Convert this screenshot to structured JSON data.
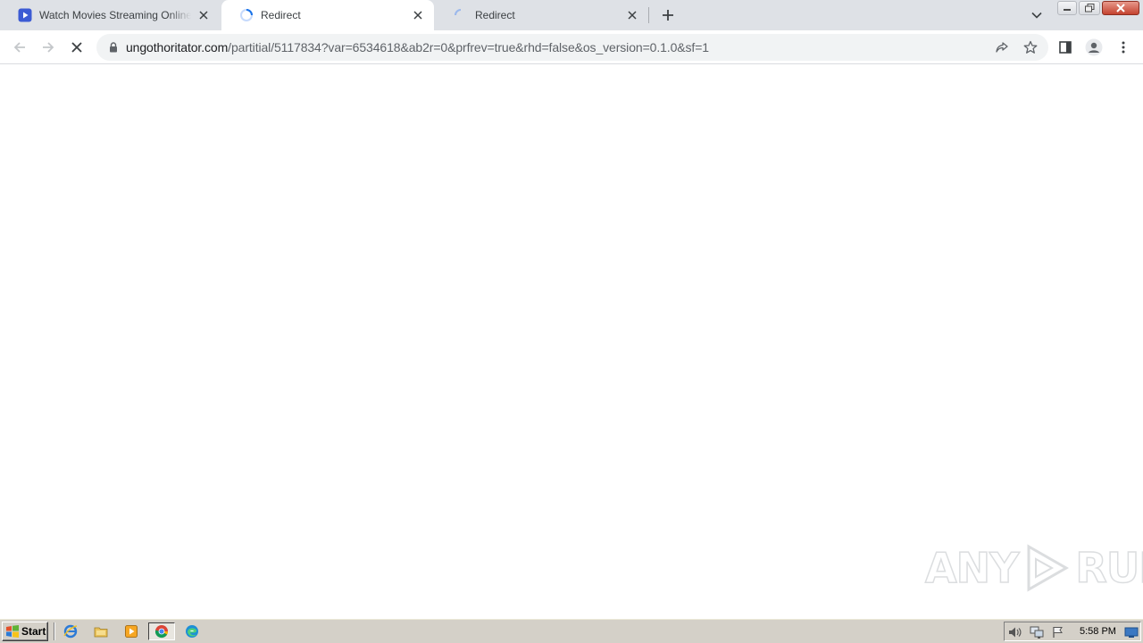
{
  "tabs": [
    {
      "title": "Watch Movies Streaming Online Free",
      "favicon": "play-video-icon",
      "loading": false,
      "active": false
    },
    {
      "title": "Redirect",
      "favicon": "loading-spinner-icon",
      "loading": true,
      "active": true
    },
    {
      "title": "Redirect",
      "favicon": "loading-spinner-icon",
      "loading": true,
      "active": false
    }
  ],
  "address_bar": {
    "host": "ungothoritator.com",
    "path": "/partitial/5117834?var=6534618&ab2r=0&prfrev=true&rhd=false&os_version=0.1.0&sf=1"
  },
  "watermark": {
    "text_left": "ANY",
    "text_right": "RUN"
  },
  "taskbar": {
    "start_label": "Start",
    "clock": "5:58 PM"
  },
  "colors": {
    "tabstrip_bg": "#dee1e6",
    "omnibox_bg": "#f1f3f4",
    "taskbar_bg": "#d4d0c8",
    "favicon_blue": "#3c5bd4",
    "spinner_blue": "#1a73e8"
  }
}
